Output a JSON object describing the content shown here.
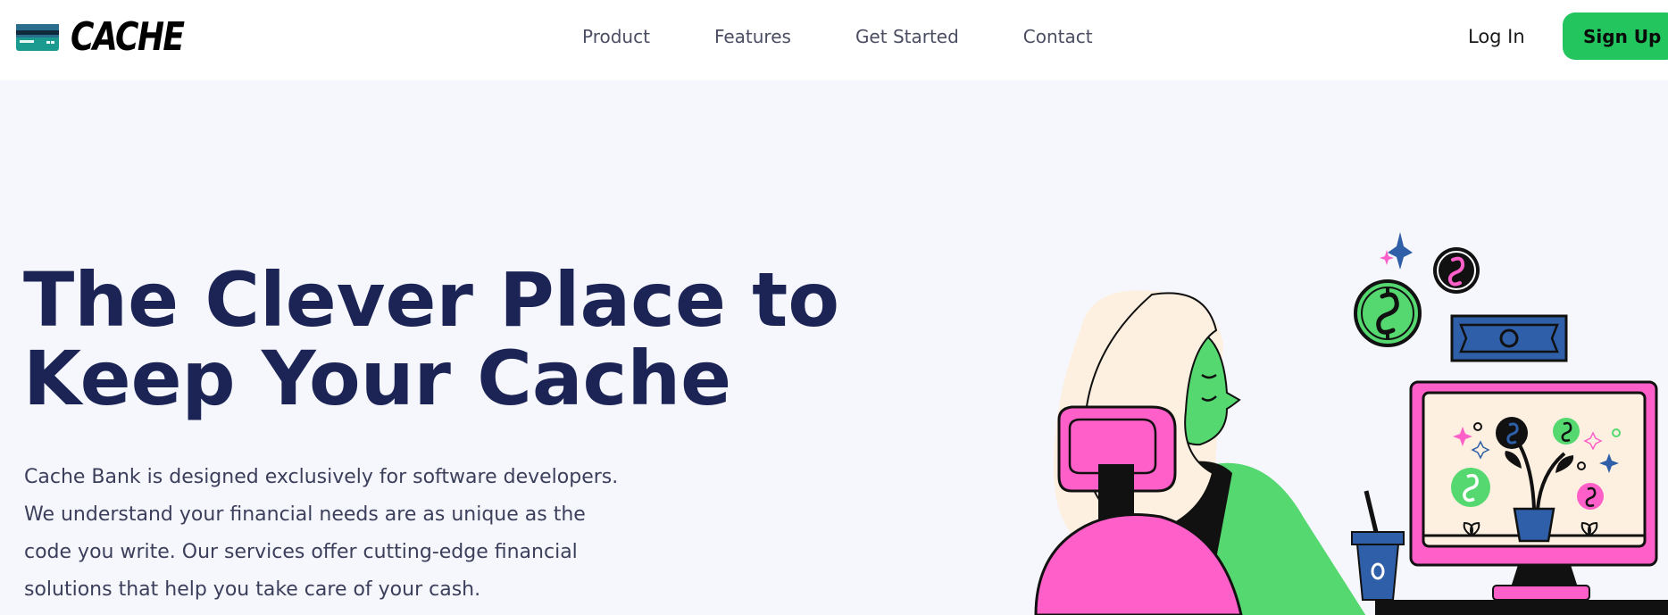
{
  "brand": {
    "name": "CACHE",
    "logo_icon": "credit-card-icon"
  },
  "nav": {
    "items": [
      {
        "label": "Product"
      },
      {
        "label": "Features"
      },
      {
        "label": "Get Started"
      },
      {
        "label": "Contact"
      }
    ],
    "login_label": "Log In",
    "signup_label": "Sign Up"
  },
  "hero": {
    "title_lines": [
      "The Clever Place to",
      "Keep Your Cache"
    ],
    "description_lines": [
      "Cache Bank is designed exclusively for software developers.",
      "We understand your financial needs are as unique as the",
      "code you write. Our services offer cutting-edge financial",
      "solutions that help you take care of your cash."
    ],
    "illustration": "woman-at-computer-with-money-illustration"
  },
  "colors": {
    "accent_green": "#22c55e",
    "title_navy": "#1c2456",
    "pink": "#ff5fc8",
    "figure_green": "#55d870",
    "blue": "#2e5fa8",
    "cream": "#fdf0e0",
    "page_bg": "#f6f7fc"
  }
}
